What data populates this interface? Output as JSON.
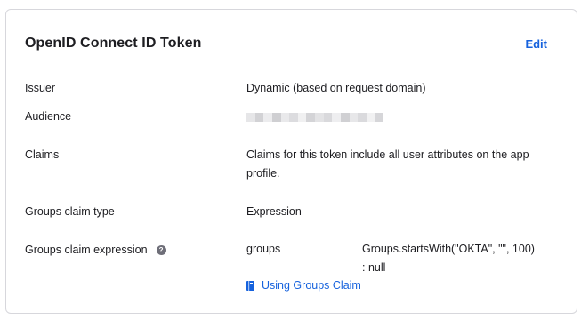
{
  "card": {
    "title": "OpenID Connect ID Token",
    "edit_label": "Edit"
  },
  "fields": {
    "issuer": {
      "label": "Issuer",
      "value": "Dynamic (based on request domain)"
    },
    "audience": {
      "label": "Audience",
      "value_obscured": true
    },
    "claims": {
      "label": "Claims",
      "value": "Claims for this token include all user attributes on the app profile."
    },
    "groups_claim_type": {
      "label": "Groups claim type",
      "value": "Expression"
    },
    "groups_claim_expression": {
      "label": "Groups claim expression",
      "help_icon": "question-circle-icon",
      "claim_name": "groups",
      "expression": "Groups.startsWith(\"OKTA\", \"\", 100) : null",
      "doc_link_label": "Using Groups Claim",
      "doc_link_icon": "book-icon"
    }
  },
  "colors": {
    "link": "#1662dd",
    "text": "#1d1d21",
    "border": "#d7d7dc"
  }
}
